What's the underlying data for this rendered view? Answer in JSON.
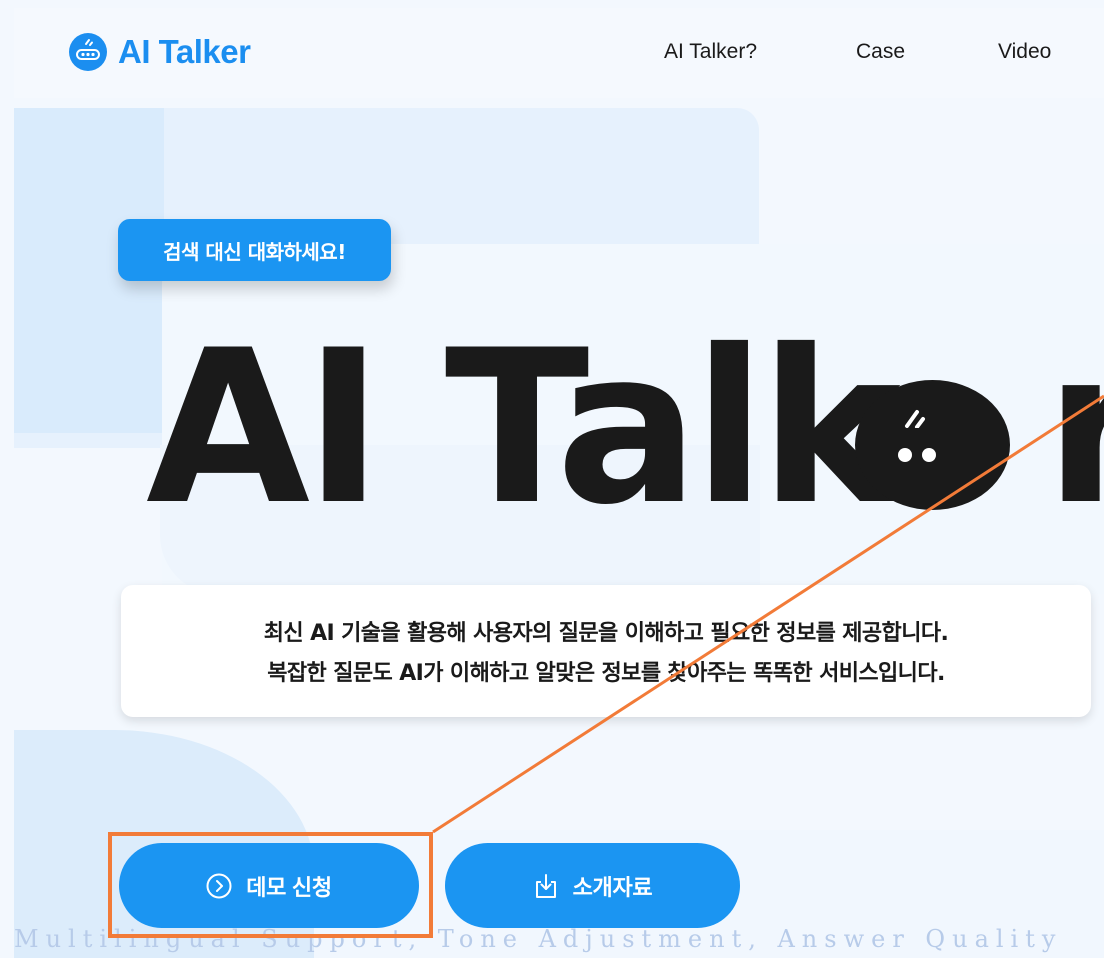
{
  "header": {
    "logo_text": "AI Talker",
    "logo_icon": "chat-bot-icon",
    "nav": [
      {
        "label": "AI Talker?"
      },
      {
        "label": "Case"
      },
      {
        "label": "Video"
      }
    ]
  },
  "hero": {
    "tag": "검색 대신 대화하세요!",
    "title": "AI Talk",
    "title_tail": "r",
    "description": [
      "최신 AI 기술을 활용해 사용자의 질문을 이해하고 필요한 정보를 제공합니다.",
      "복잡한 질문도 AI가 이해하고 알맞은 정보를 찾아주는 똑똑한 서비스입니다."
    ]
  },
  "buttons": {
    "demo_label": "데모 신청",
    "demo_icon": "chevron-right-circle-icon",
    "intro_label": "소개자료",
    "intro_icon": "download-icon"
  },
  "marquee": "Multilingual Support, Tone Adjustment, Answer Quality",
  "colors": {
    "brand": "#1b95f2",
    "text": "#1a1a1a",
    "highlight": "#f27b38"
  }
}
